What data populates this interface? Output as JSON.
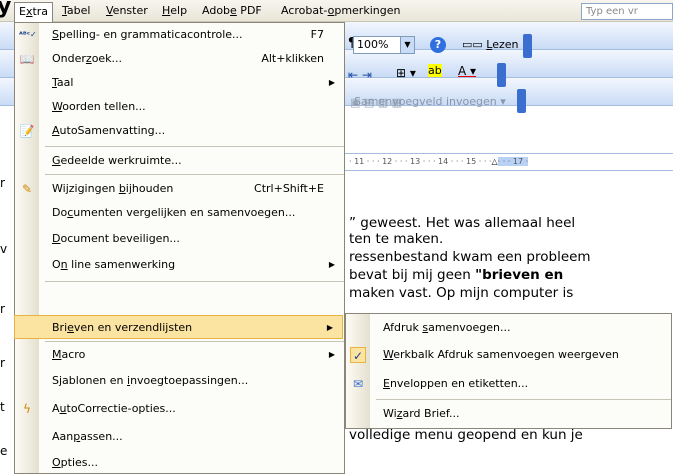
{
  "menubar": {
    "items": [
      {
        "pre": "E",
        "ul": "x",
        "post": "tra"
      },
      {
        "pre": "",
        "ul": "T",
        "post": "abel"
      },
      {
        "pre": "",
        "ul": "V",
        "post": "enster"
      },
      {
        "pre": "",
        "ul": "H",
        "post": "elp"
      },
      {
        "pre": "Adob",
        "ul": "e",
        "post": " PDF"
      },
      {
        "pre": "Acrobat-",
        "ul": "o",
        "post": "pmerkingen"
      }
    ],
    "help_placeholder": "Typ een vr"
  },
  "toolbar": {
    "zoom": "100%",
    "read_prefix": "",
    "read_ul": "L",
    "read_post": "ezen",
    "merge_field_label": "Samenvoegveld invoegen",
    "ruler_marks": "· 11 · · · 12 · · · 13 · · · 14 · · · 15 · · ·",
    "ruler_tail": "· · · 17 ·"
  },
  "extra_menu": {
    "items": [
      {
        "pre": "",
        "ul": "S",
        "post": "pelling- en grammaticacontrole...",
        "shortcut": "F7",
        "icon": "spellcheck-icon"
      },
      {
        "pre": "Onder",
        "ul": "z",
        "post": "oek...",
        "shortcut": "Alt+klikken",
        "icon": "research-icon"
      },
      {
        "pre": "",
        "ul": "T",
        "post": "aal",
        "shortcut": "",
        "icon": "",
        "submenu": true
      },
      {
        "pre": "",
        "ul": "W",
        "post": "oorden tellen...",
        "shortcut": "",
        "icon": ""
      },
      {
        "pre": "",
        "ul": "A",
        "post": "utoSamenvatting...",
        "shortcut": "",
        "icon": "autosummary-icon"
      },
      {
        "pre": "",
        "ul": "G",
        "post": "edeelde werkruimte...",
        "shortcut": "",
        "icon": ""
      },
      {
        "pre": "Wijzigingen ",
        "ul": "b",
        "post": "ijhouden",
        "shortcut": "Ctrl+Shift+E",
        "icon": "track-changes-icon"
      },
      {
        "pre": "Do",
        "ul": "c",
        "post": "umenten vergelijken en samenvoegen...",
        "shortcut": "",
        "icon": ""
      },
      {
        "pre": "",
        "ul": "D",
        "post": "ocument beveiligen...",
        "shortcut": "",
        "icon": ""
      },
      {
        "pre": "O",
        "ul": "n",
        "post": " line samenwerking",
        "shortcut": "",
        "icon": "",
        "submenu": true
      },
      {
        "pre": "Bri",
        "ul": "e",
        "post": "ven en verzendlijsten",
        "shortcut": "",
        "icon": "",
        "submenu": true
      },
      {
        "pre": "",
        "ul": "M",
        "post": "acro",
        "shortcut": "",
        "icon": "",
        "submenu": true
      },
      {
        "pre": "Sjablonen en ",
        "ul": "i",
        "post": "nvoegtoepassingen...",
        "shortcut": "",
        "icon": ""
      },
      {
        "pre": "A",
        "ul": "u",
        "post": "toCorrectie-opties...",
        "shortcut": "",
        "icon": "autocorrect-icon"
      },
      {
        "pre": "Aan",
        "ul": "p",
        "post": "assen...",
        "shortcut": "",
        "icon": ""
      },
      {
        "pre": "",
        "ul": "O",
        "post": "pties...",
        "shortcut": "",
        "icon": ""
      }
    ]
  },
  "sub_menu": {
    "items": [
      {
        "pre": "Afdruk ",
        "ul": "s",
        "post": "amenvoegen...",
        "icon": ""
      },
      {
        "pre": "",
        "ul": "W",
        "post": "erkbalk Afdruk samenvoegen weergeven",
        "icon": "checkmark-icon"
      },
      {
        "pre": "",
        "ul": "E",
        "post": "nveloppen en etiketten...",
        "icon": "envelope-icon"
      },
      {
        "pre": "Wi",
        "ul": "z",
        "post": "ard Brief...",
        "icon": ""
      }
    ]
  },
  "document": {
    "lines": [
      "” geweest. Het was allemaal heel",
      "ten te maken.",
      "ressenbestand kwam een probleem",
      " bevat bij mij geen ",
      " maken vast. Op mijn computer is",
      "volledige menu geopend en kun je"
    ],
    "bold_phrase": "\"brieven en"
  }
}
